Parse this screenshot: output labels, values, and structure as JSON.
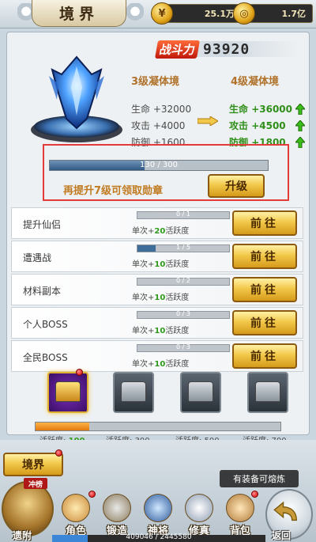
{
  "header": {
    "title": "境界",
    "currency_1": {
      "icon": "silver-ingot-icon",
      "value": "25.1万"
    },
    "currency_2": {
      "icon": "gold-coin-icon",
      "value": "1.7亿"
    }
  },
  "realm": {
    "combat_power_label": "战斗力",
    "combat_power_value": "93920",
    "current_realm": "3级凝体境",
    "next_realm": "4级凝体境",
    "current_stats": [
      {
        "label": "生命",
        "value": "+32000"
      },
      {
        "label": "攻击",
        "value": "+4000"
      },
      {
        "label": "防御",
        "value": "+1600"
      }
    ],
    "next_stats": [
      {
        "label": "生命",
        "value": "+36000"
      },
      {
        "label": "攻击",
        "value": "+4500"
      },
      {
        "label": "防御",
        "value": "+1800"
      }
    ],
    "progress": {
      "current": 130,
      "max": 300,
      "text": "130 / 300"
    },
    "hint": "再提升7级可领取勋章",
    "upgrade_label": "升级"
  },
  "tasks": [
    {
      "name": "提升仙侣",
      "progress_text": "0 / 1",
      "progress": 0,
      "desc_prefix": "单次+",
      "desc_num": "20",
      "desc_suffix": "活跃度",
      "button": "前往"
    },
    {
      "name": "遭遇战",
      "progress_text": "1 / 5",
      "progress": 0.2,
      "desc_prefix": "单次+",
      "desc_num": "10",
      "desc_suffix": "活跃度",
      "button": "前往"
    },
    {
      "name": "材料副本",
      "progress_text": "0 / 2",
      "progress": 0,
      "desc_prefix": "单次+",
      "desc_num": "10",
      "desc_suffix": "活跃度",
      "button": "前往"
    },
    {
      "name": "个人BOSS",
      "progress_text": "0 / 3",
      "progress": 0,
      "desc_prefix": "单次+",
      "desc_num": "10",
      "desc_suffix": "活跃度",
      "button": "前往"
    },
    {
      "name": "全民BOSS",
      "progress_text": "0 / 3",
      "progress": 0,
      "desc_prefix": "单次+",
      "desc_num": "10",
      "desc_suffix": "活跃度",
      "button": "前往"
    }
  ],
  "activity": {
    "progress": 0.22,
    "milestones": [
      {
        "label": "活跃度:",
        "value": "100",
        "done": true
      },
      {
        "label": "活跃度:",
        "value": "300",
        "done": false
      },
      {
        "label": "活跃度:",
        "value": "500",
        "done": false
      },
      {
        "label": "活跃度:",
        "value": "700",
        "done": false
      }
    ]
  },
  "bottom": {
    "realm_tab": "境界",
    "rank_badge": "冲榜",
    "tooltip": "有装备可熔炼",
    "exp_text": "409046 / 2445580",
    "exp_progress": 0.167,
    "side_label": "遗附",
    "return_label": "返回",
    "nav": [
      {
        "label": "角色",
        "icon": "character-icon"
      },
      {
        "label": "锻造",
        "icon": "hammer-icon"
      },
      {
        "label": "神将",
        "icon": "general-icon"
      },
      {
        "label": "修真",
        "icon": "cultivation-icon"
      },
      {
        "label": "背包",
        "icon": "bag-icon"
      }
    ]
  }
}
